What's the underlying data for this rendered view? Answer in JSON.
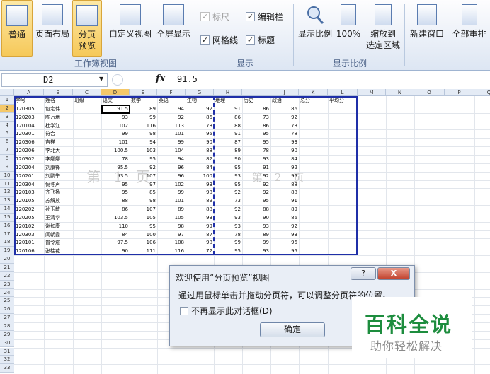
{
  "ribbon": {
    "views": [
      {
        "label": "普通",
        "active": true
      },
      {
        "label": "页面布局",
        "active": false
      },
      {
        "label": "分页\n预览",
        "active": true
      },
      {
        "label": "自定义视图",
        "active": false
      },
      {
        "label": "全屏显示",
        "active": false
      }
    ],
    "group_views": "工作簿视图",
    "show": {
      "ruler": {
        "label": "标尺",
        "checked": true,
        "disabled": true
      },
      "formula_bar": {
        "label": "编辑栏",
        "checked": true
      },
      "gridlines": {
        "label": "网格线",
        "checked": true
      },
      "headings": {
        "label": "标题",
        "checked": true
      }
    },
    "group_show": "显示",
    "zoom": {
      "zoom_label": "显示比例",
      "zoom100_label": "100%",
      "zoom_sel_label": "缩放到\n选定区域"
    },
    "group_zoom": "显示比例",
    "window": {
      "new_window": "新建窗口",
      "arrange_all": "全部重排"
    }
  },
  "formula_bar": {
    "name_box": "D2",
    "fx": "fx",
    "value": "91.5"
  },
  "sheet": {
    "columns": [
      "A",
      "B",
      "C",
      "D",
      "E",
      "F",
      "G",
      "H",
      "I",
      "J",
      "K",
      "L",
      "M",
      "N",
      "O",
      "P",
      "Q"
    ],
    "selected_column": "D",
    "header_row": [
      "学号",
      "姓名",
      "班级",
      "语文",
      "数学",
      "英语",
      "生物",
      "地理",
      "历史",
      "政治",
      "总分",
      "平均分"
    ],
    "rows": [
      [
        "120305",
        "包宏伟",
        "",
        "91.5",
        "89",
        "94",
        "92",
        "91",
        "86",
        "86"
      ],
      [
        "120203",
        "陈万地",
        "",
        "93",
        "99",
        "92",
        "86",
        "86",
        "73",
        "92"
      ],
      [
        "120104",
        "杜学江",
        "",
        "102",
        "116",
        "113",
        "78",
        "88",
        "86",
        "73"
      ],
      [
        "120301",
        "符合",
        "",
        "99",
        "98",
        "101",
        "95",
        "91",
        "95",
        "78"
      ],
      [
        "120306",
        "吉祥",
        "",
        "101",
        "94",
        "99",
        "90",
        "87",
        "95",
        "93"
      ],
      [
        "120206",
        "李北大",
        "",
        "100.5",
        "103",
        "104",
        "88",
        "89",
        "78",
        "90"
      ],
      [
        "120302",
        "李娜娜",
        "",
        "78",
        "95",
        "94",
        "82",
        "90",
        "93",
        "84"
      ],
      [
        "120204",
        "刘康锋",
        "",
        "95.5",
        "92",
        "96",
        "84",
        "95",
        "91",
        "92"
      ],
      [
        "120201",
        "刘鹏举",
        "",
        "93.5",
        "107",
        "96",
        "100",
        "93",
        "92",
        "93"
      ],
      [
        "120304",
        "倪冬声",
        "",
        "95",
        "97",
        "102",
        "93",
        "95",
        "92",
        "88"
      ],
      [
        "120103",
        "齐飞扬",
        "",
        "95",
        "85",
        "99",
        "98",
        "92",
        "92",
        "88"
      ],
      [
        "120105",
        "苏解放",
        "",
        "88",
        "98",
        "101",
        "89",
        "73",
        "95",
        "91"
      ],
      [
        "120202",
        "孙玉敏",
        "",
        "86",
        "107",
        "89",
        "88",
        "92",
        "88",
        "89"
      ],
      [
        "120205",
        "王清华",
        "",
        "103.5",
        "105",
        "105",
        "93",
        "93",
        "90",
        "86"
      ],
      [
        "120102",
        "谢如康",
        "",
        "110",
        "95",
        "98",
        "99",
        "93",
        "93",
        "92"
      ],
      [
        "120303",
        "闫朝霞",
        "",
        "84",
        "100",
        "97",
        "87",
        "78",
        "89",
        "93"
      ],
      [
        "120101",
        "曾令煊",
        "",
        "97.5",
        "106",
        "108",
        "98",
        "99",
        "99",
        "96"
      ],
      [
        "120106",
        "张桂花",
        "",
        "90",
        "111",
        "116",
        "72",
        "95",
        "93",
        "95"
      ]
    ],
    "row_count": 33,
    "selected_row": 2,
    "page1": "第 1 页",
    "page2": "第 2 页"
  },
  "dialog": {
    "title": "欢迎使用“分页预览”视图",
    "help": "?",
    "close": "X",
    "message": "通过用鼠标单击并拖动分页符，可以调整分页符的位置。",
    "checkbox": "不再显示此对话框(D)",
    "ok": "确定"
  },
  "logo": {
    "line1": "百科全说",
    "line2": "助你轻松解决"
  },
  "colors": {
    "accent": "#f6c95a",
    "page_border": "#1f2fa8",
    "logo_green": "#1d8d3e"
  }
}
